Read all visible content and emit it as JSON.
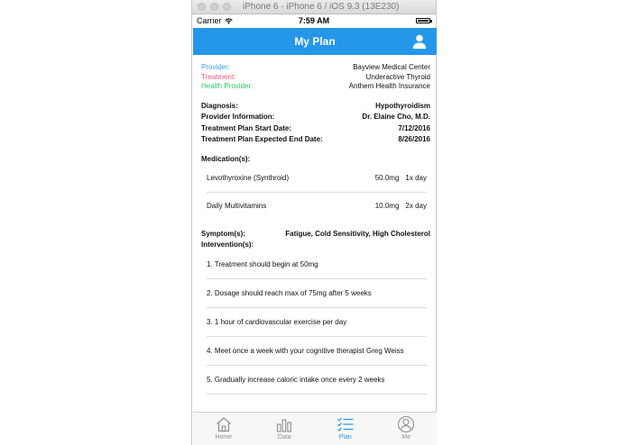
{
  "simulator": {
    "window_title": "iPhone 6 - iPhone 6 / iOS 9.3 (13E230)"
  },
  "status_bar": {
    "carrier": "Carrier",
    "time": "7:59 AM"
  },
  "nav": {
    "title": "My Plan",
    "right_icon": "user-icon"
  },
  "provider_info": {
    "provider_label": "Provider:",
    "provider_value": "Bayview Medical Center",
    "treatment_label": "Treatment:",
    "treatment_value": "Underactive Thyroid",
    "health_label": "Health Provider:",
    "health_value": "Anthem Health Insurance"
  },
  "details": {
    "diagnosis_label": "Diagnosis:",
    "diagnosis_value": "Hypothyroidism",
    "provider_label": "Provider Information:",
    "provider_value": "Dr. Elaine Cho, M.D.",
    "start_label": "Treatment Plan Start Date:",
    "start_value": "7/12/2016",
    "end_label": "Treatment Plan Expected End Date:",
    "end_value": "8/26/2016"
  },
  "medication": {
    "label": "Medication(s):",
    "items": [
      {
        "name": "Levothyroxine (Synthroid)",
        "dose": "50.0mg",
        "frequency": "1x day"
      },
      {
        "name": "Daily Multivitamins",
        "dose": "10.0mg",
        "frequency": "2x day"
      }
    ]
  },
  "symptoms": {
    "label": "Symptom(s):",
    "value": "Fatigue, Cold Sensitivity, High Cholesterol"
  },
  "interventions": {
    "label": "Intervention(s):",
    "items": [
      "1. Treatment should begin at 50mg",
      "2. Dosage should reach max of 75mg after 5 weeks",
      "3. 1 hour of cardiovascular exercise per day",
      "4. Meet once a week with your cognitive therapist Greg Weiss",
      "5. Gradually increase caloric intake once every 2 weeks"
    ]
  },
  "tabs": [
    {
      "label": "Home",
      "icon": "home-icon"
    },
    {
      "label": "Data",
      "icon": "bar-chart-icon"
    },
    {
      "label": "Plan",
      "icon": "list-icon"
    },
    {
      "label": "Me",
      "icon": "user-circle-icon"
    }
  ],
  "colors": {
    "nav_background": "#2497e8",
    "provider_label": "#3aa0f0",
    "treatment_label": "#f05a78",
    "health_label": "#30c56a",
    "tab_active": "#2497e8",
    "tab_inactive": "#8e8e8e"
  }
}
